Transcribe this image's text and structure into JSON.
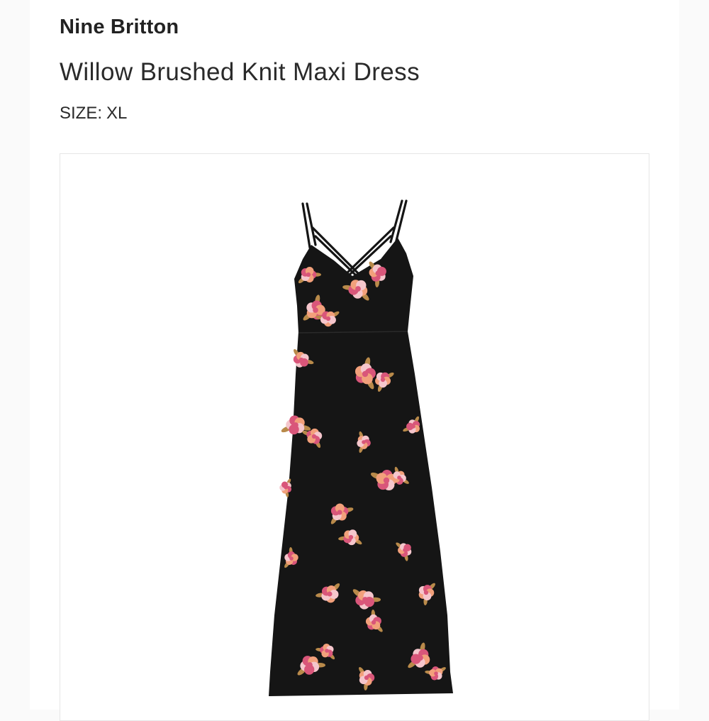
{
  "product": {
    "brand": "Nine Britton",
    "name": "Willow Brushed Knit Maxi Dress",
    "size_label": "SIZE:",
    "size_value": "XL"
  },
  "image": {
    "icon": "dress-photo",
    "dress_color": "#141414",
    "flower_colors": [
      "#d9567a",
      "#f2a07b",
      "#f5c6cc"
    ],
    "leaf_color": "#b98a4a"
  }
}
